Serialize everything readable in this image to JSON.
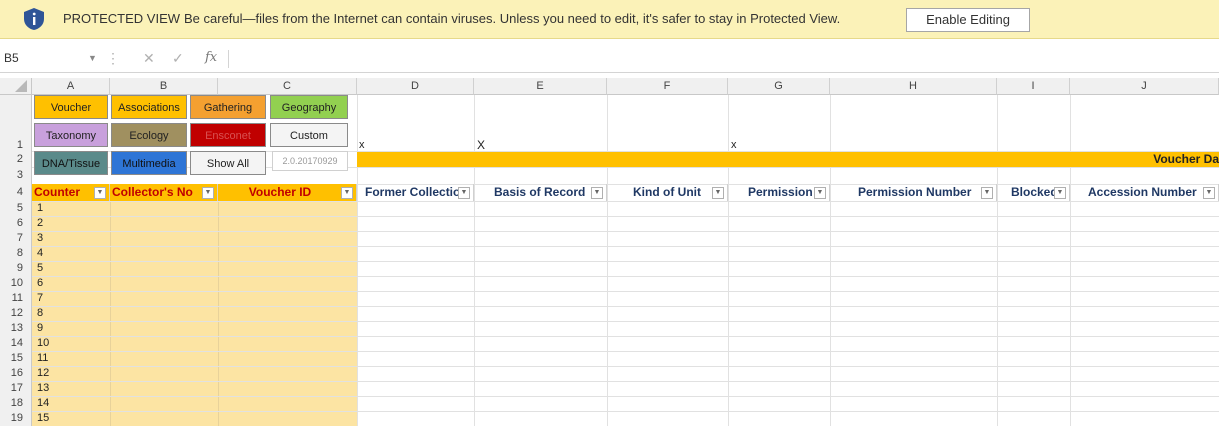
{
  "protected_view": {
    "title": "PROTECTED VIEW",
    "message": "Be careful—files from the Internet can contain viruses. Unless you need to edit, it's safer to stay in Protected View.",
    "enable_button": "Enable Editing"
  },
  "formula_bar": {
    "name_box": "B5",
    "fx": "fx"
  },
  "columns": [
    "A",
    "B",
    "C",
    "D",
    "E",
    "F",
    "G",
    "H",
    "I",
    "J"
  ],
  "rows": [
    "1",
    "2",
    "3",
    "4",
    "5",
    "6",
    "7",
    "8",
    "9",
    "10",
    "11",
    "12",
    "13",
    "14",
    "15",
    "16",
    "17",
    "18",
    "19"
  ],
  "nav_buttons": {
    "voucher": "Voucher",
    "associations": "Associations",
    "gathering": "Gathering",
    "geography": "Geography",
    "taxonomy": "Taxonomy",
    "ecology": "Ecology",
    "ensconet": "Ensconet",
    "custom": "Custom",
    "dna_tissue": "DNA/Tissue",
    "multimedia": "Multimedia",
    "show_all": "Show All"
  },
  "version": "2.0.20170929",
  "x_marks": [
    "x",
    "X",
    "x"
  ],
  "banner": "Voucher Da",
  "headers": {
    "counter": "Counter",
    "collectors_no": "Collector's No",
    "voucher_id": "Voucher ID",
    "former_collection": "Former Collectio",
    "basis_of_record": "Basis of Record",
    "kind_of_unit": "Kind of Unit",
    "permission": "Permission",
    "permission_number": "Permission Number",
    "blocked": "Blocked",
    "accession_number": "Accession Number"
  },
  "counters": [
    "1",
    "2",
    "3",
    "4",
    "5",
    "6",
    "7",
    "8",
    "9",
    "10",
    "11",
    "12",
    "13",
    "14",
    "15"
  ],
  "colors": {
    "voucher": "#ffc000",
    "associations": "#ffc000",
    "gathering": "#f4a030",
    "geography": "#92d050",
    "taxonomy": "#c8a0dc",
    "ecology": "#a09060",
    "ensconet": "#c00000",
    "dna_tissue": "#5a8a8a",
    "multimedia": "#2e75d6",
    "banner": "#ffc000",
    "tan_cells": "#fce4a3"
  }
}
